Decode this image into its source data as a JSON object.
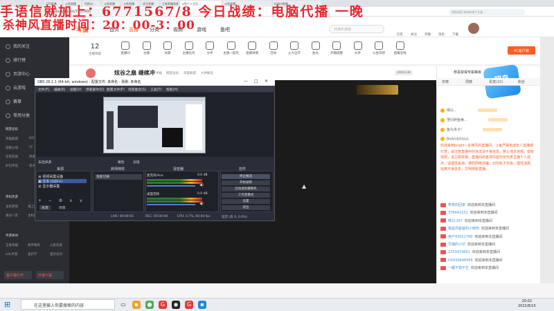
{
  "browser": {
    "tabs": [
      "376直播",
      "斗鱼直播",
      "阿斯达...",
      "斗鱼直播",
      "斗鱼直播",
      "虎牙直播",
      "王者荣耀直播...",
      "斗鱼个人主页...",
      "斗鱼直播",
      "bilibili直播..."
    ],
    "url": "www.douyu.com/7777900",
    "search_placeholder": "搜狗搜索 微软新增千亿级..."
  },
  "overlay": {
    "line1": "手语信就加上：6771567/8 今日战绩：电脑代播 一晚",
    "line2": "杀神风直播时间：20：00-3：00"
  },
  "nav": {
    "logo": "斗鱼",
    "items": [
      "首页",
      "直播",
      "分类",
      "视频",
      "游戏",
      "鱼吧"
    ],
    "search_placeholder": "刘涛手游挑",
    "user_icons": [
      "历史",
      "关注",
      "开播",
      "消息",
      "下载"
    ]
  },
  "sidebar": {
    "items": [
      "我的关注",
      "排行榜",
      "页游中心",
      "云游戏",
      "赛事",
      "常用分类"
    ],
    "sections": [
      {
        "title": "网游竞技",
        "tags": [
          "英雄联盟",
          "DOTA2",
          "穿越火线",
          "CF",
          "守望先锋",
          "传奇",
          "炉石传说",
          "逆水寒"
        ]
      },
      {
        "title": "单机热游",
        "tags": [
          "主机游戏",
          "海上生活",
          "我的世界",
          "鬼谷八荒",
          "主机传说",
          "怀旧游戏"
        ]
      },
      {
        "title": "手游休闲",
        "tags": [
          "王者荣耀",
          "和平精英",
          "火影忍者",
          "LOL手游",
          "金铲铲",
          "蛋仔派对"
        ]
      }
    ],
    "btn_left": "客户端打开",
    "btn_right": "开播下载"
  },
  "toolbar": {
    "level": "12",
    "level_label": "主播等级",
    "items": [
      "直播间",
      "主播",
      "贡献",
      "主播任务",
      "分享",
      "主播一起玩",
      "直播详情",
      "活动",
      "火力全开",
      "鱼丸",
      "开播提醒",
      "分享",
      "斗鱼玩吧",
      "直播连线"
    ],
    "pc_btn": "PC客户端"
  },
  "room": {
    "title": "炫谷之扇 继续冲",
    "tags": [
      "举报",
      "网游竞技",
      "英雄联盟",
      "大神解说"
    ],
    "badge": "2003136"
  },
  "right_panel": {
    "tabs": [
      "日榜",
      "周榜",
      "贵宾(22)",
      "粉丝"
    ],
    "notice_title": "恭喜获得专属等级",
    "ranks": [
      "晴以...",
      "澄衍醉鱼美...",
      "鱼丸舟子!",
      "BeAmbitious"
    ],
    "notice": "欢迎来到bright~杀神风的直播间。斗鱼严禁未成年人直播或打赏，请注意直播中的违法及不良信息，禁止违法违规。如有违规，请立即举报。直播间的各项内容均仅代表主播个人观点，请理性看待。谨防网络诈骗，切勿私下交易，理性消费，远离不良信息，文明观看直播。",
    "chats": [
      {
        "name": "笑笑的回家",
        "msg": "欢迎来到本直播间"
      },
      {
        "name": "378442152",
        "msg": "欢迎来到本直播间"
      },
      {
        "name": "啊21167",
        "msg": "欢迎来到本直播间"
      },
      {
        "name": "我是你爸爸的小鲜肉",
        "msg": "欢迎来到本直播间"
      },
      {
        "name": "用户93011760",
        "msg": "欢迎来到本直播间"
      },
      {
        "name": "灵魂的小伙",
        "msg": "欢迎来到本直播间"
      },
      {
        "name": "2253433661",
        "msg": "欢迎来到本直播间"
      },
      {
        "name": "DSSSS8d8066",
        "msg": "欢迎来到本直播间"
      },
      {
        "name": "一鲤不错不生",
        "msg": "欢迎来到本直播间"
      }
    ]
  },
  "ad": {
    "label": "超鸟"
  },
  "obs": {
    "title": "OBS 26.1.1 (64-bit, windows) - 配置文件: 未命名 - 场景: 未命名",
    "menu": [
      "文件(F)",
      "编辑(E)",
      "视图(V)",
      "停靠部件(D)",
      "配置文件(P)",
      "场景集合(S)",
      "工具(T)",
      "帮助(H)"
    ],
    "preview_bar": [
      "未选择源",
      "属性",
      "滤镜"
    ],
    "dock_headers": [
      "来源",
      "转场特效",
      "混音器",
      "控件"
    ],
    "sources": [
      "视频采集设备",
      "文本 (GDI+)",
      "显示器采集"
    ],
    "transition": "渐变切换",
    "mixer": [
      {
        "name": "麦克风/Aux",
        "db": "0.0 dB"
      },
      {
        "name": "桌面音频",
        "db": "0.0 dB"
      }
    ],
    "controls": [
      "停止推流",
      "开始录制",
      "启动虚拟摄像机",
      "工作室模式",
      "设置",
      "退出"
    ],
    "scene_tabs": [
      "来源",
      "场景"
    ],
    "status": [
      "LIVE: 00:00:00",
      "REC: 00:00:00",
      "CPU: 0.7%, 60.00 fps",
      "延迟 (丢 0, 0.0%)"
    ]
  },
  "taskbar": {
    "search": "在这里输入你要搜索的内容",
    "time": "20:02",
    "date": "2022/8/15"
  }
}
